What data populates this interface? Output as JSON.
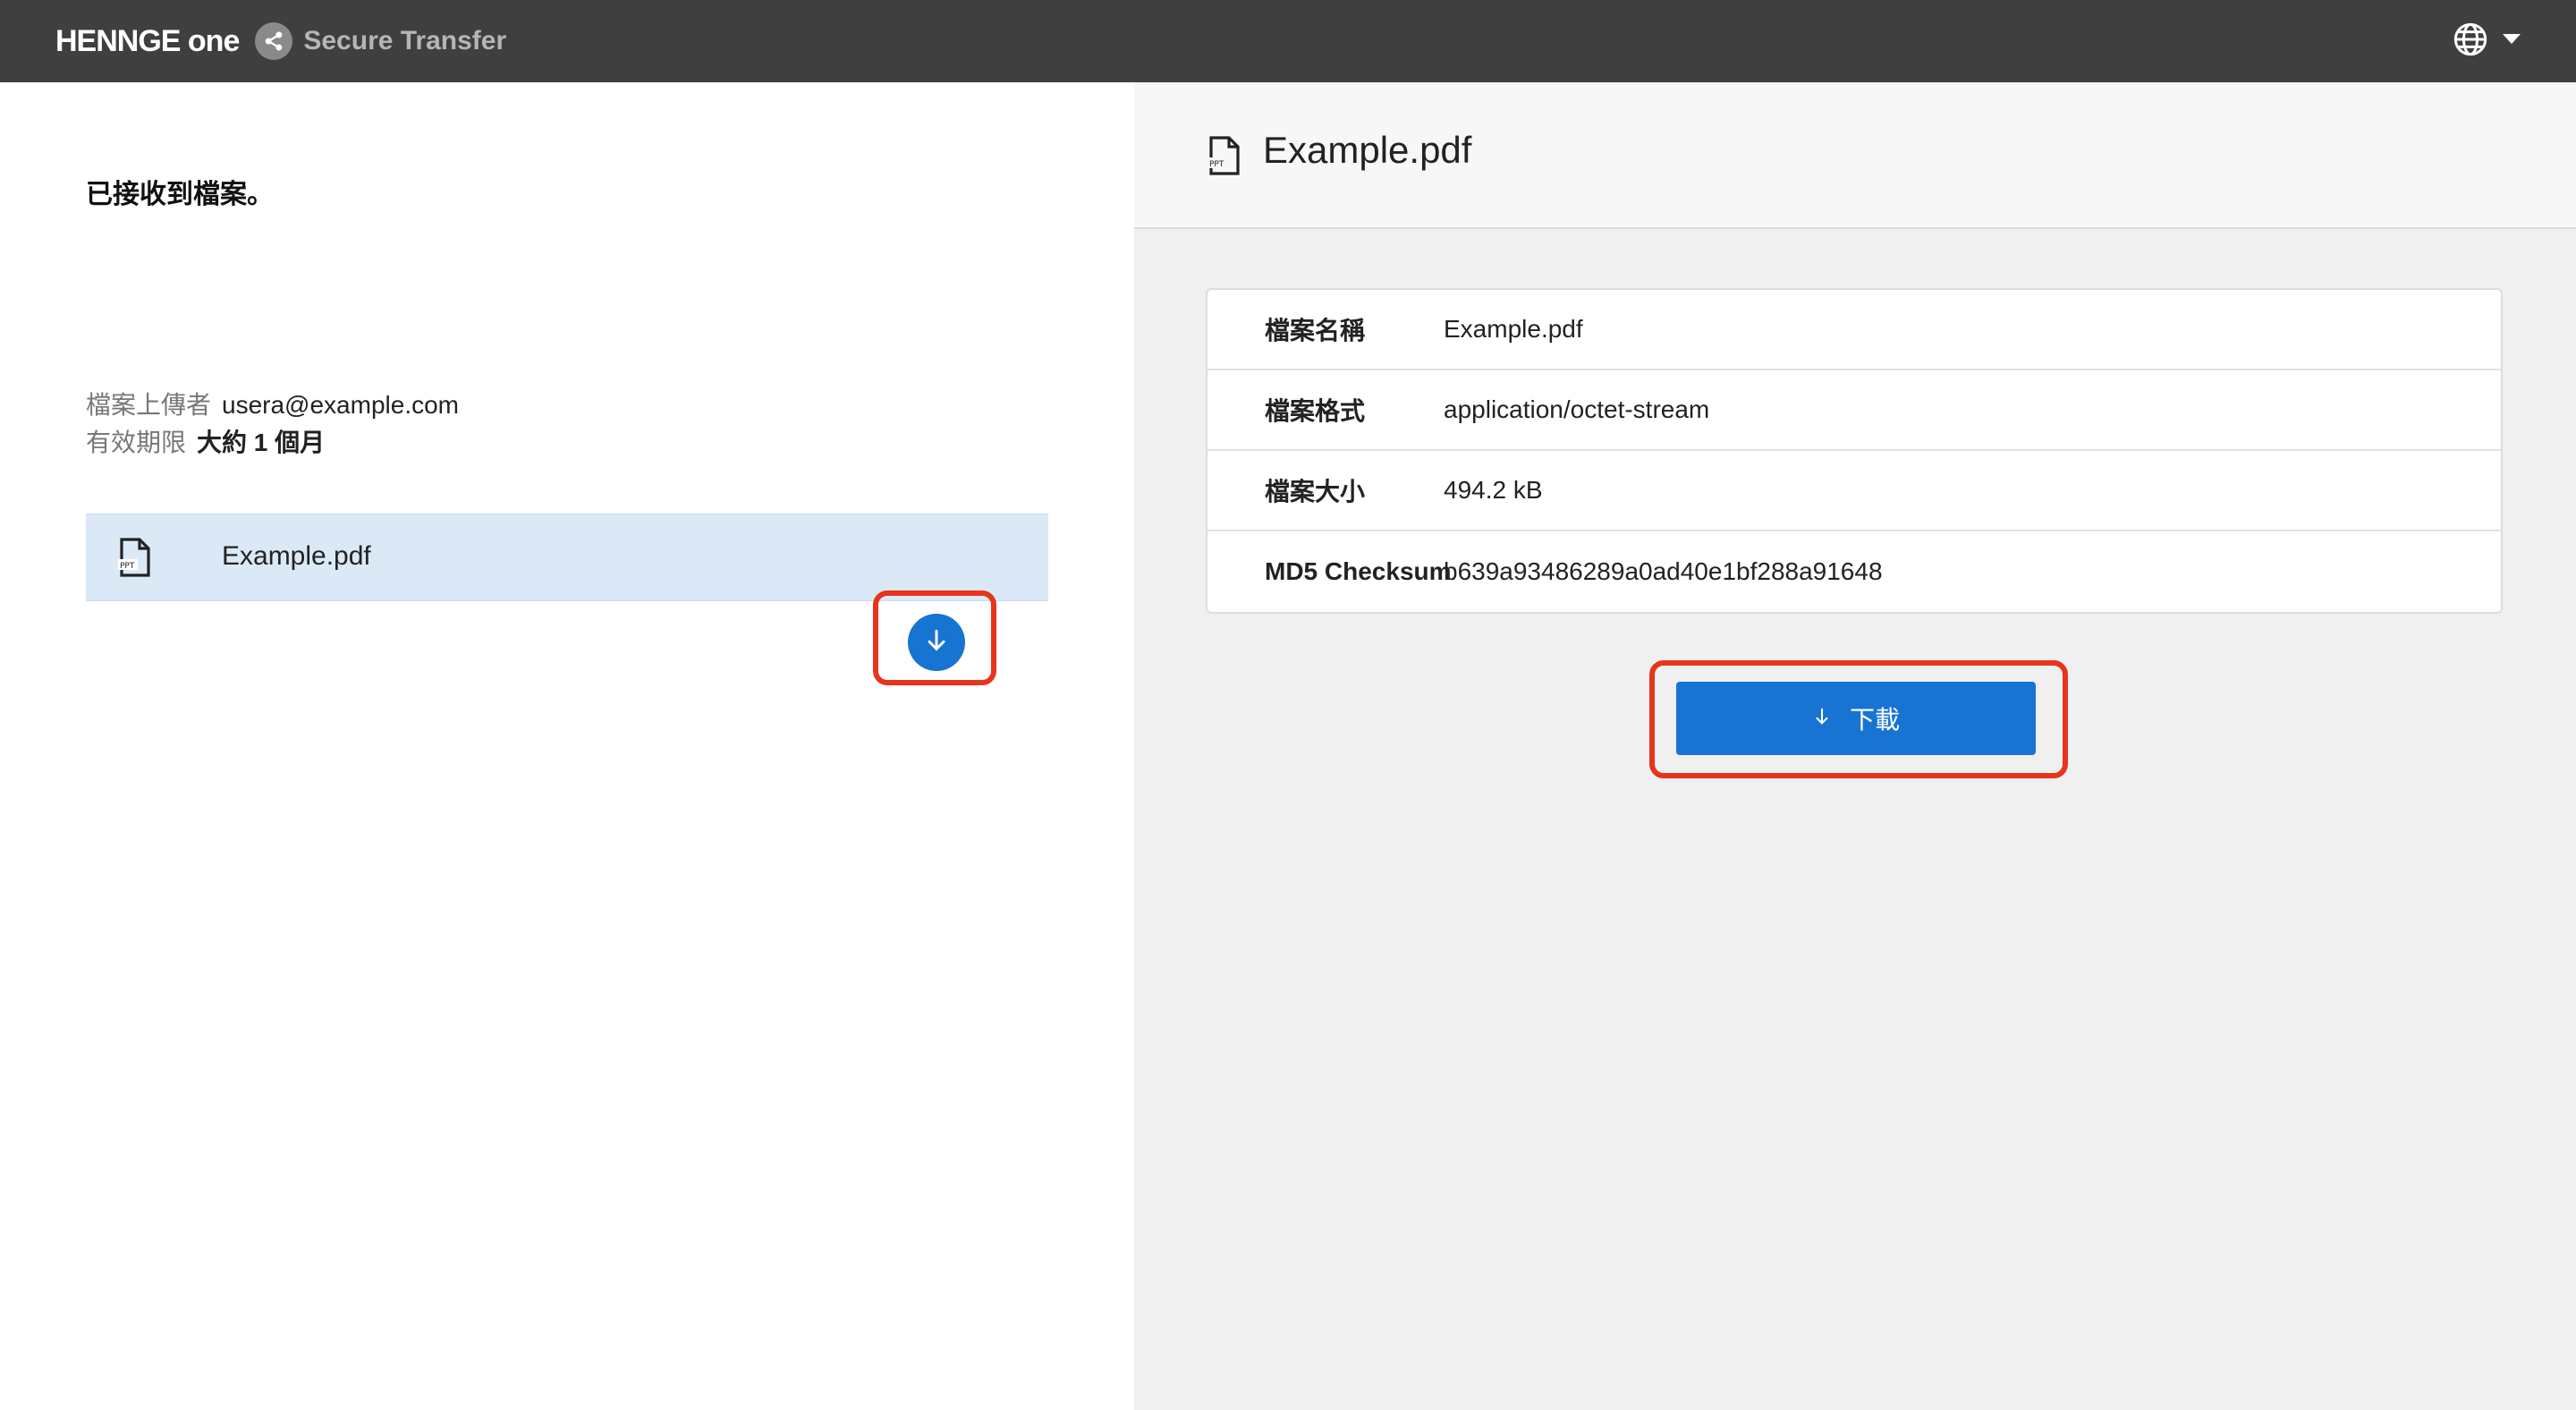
{
  "header": {
    "brand": "HENNGE one",
    "product": "Secure Transfer",
    "language_icon": "globe-icon",
    "language_caret_icon": "caret-down-icon"
  },
  "left": {
    "status": "已接收到檔案。",
    "uploader_label": "檔案上傳者",
    "uploader_value": "usera@example.com",
    "expiry_label": "有效期限",
    "expiry_value": "大約 1 個月",
    "file": {
      "name": "Example.pdf",
      "icon": "file-icon",
      "download_icon": "arrow-down-icon"
    }
  },
  "right": {
    "title": "Example.pdf",
    "details": [
      {
        "key": "檔案名稱",
        "value": "Example.pdf"
      },
      {
        "key": "檔案格式",
        "value": "application/octet-stream"
      },
      {
        "key": "檔案大小",
        "value": "494.2 kB"
      },
      {
        "key": "MD5 Checksum",
        "value": "b639a93486289a0ad40e1bf288a91648"
      }
    ],
    "download_label": "下載"
  },
  "colors": {
    "topbar": "#3f3f3f",
    "accent": "#1874d2",
    "highlight": "#e8341c",
    "selected_row": "#dbe9f7"
  }
}
